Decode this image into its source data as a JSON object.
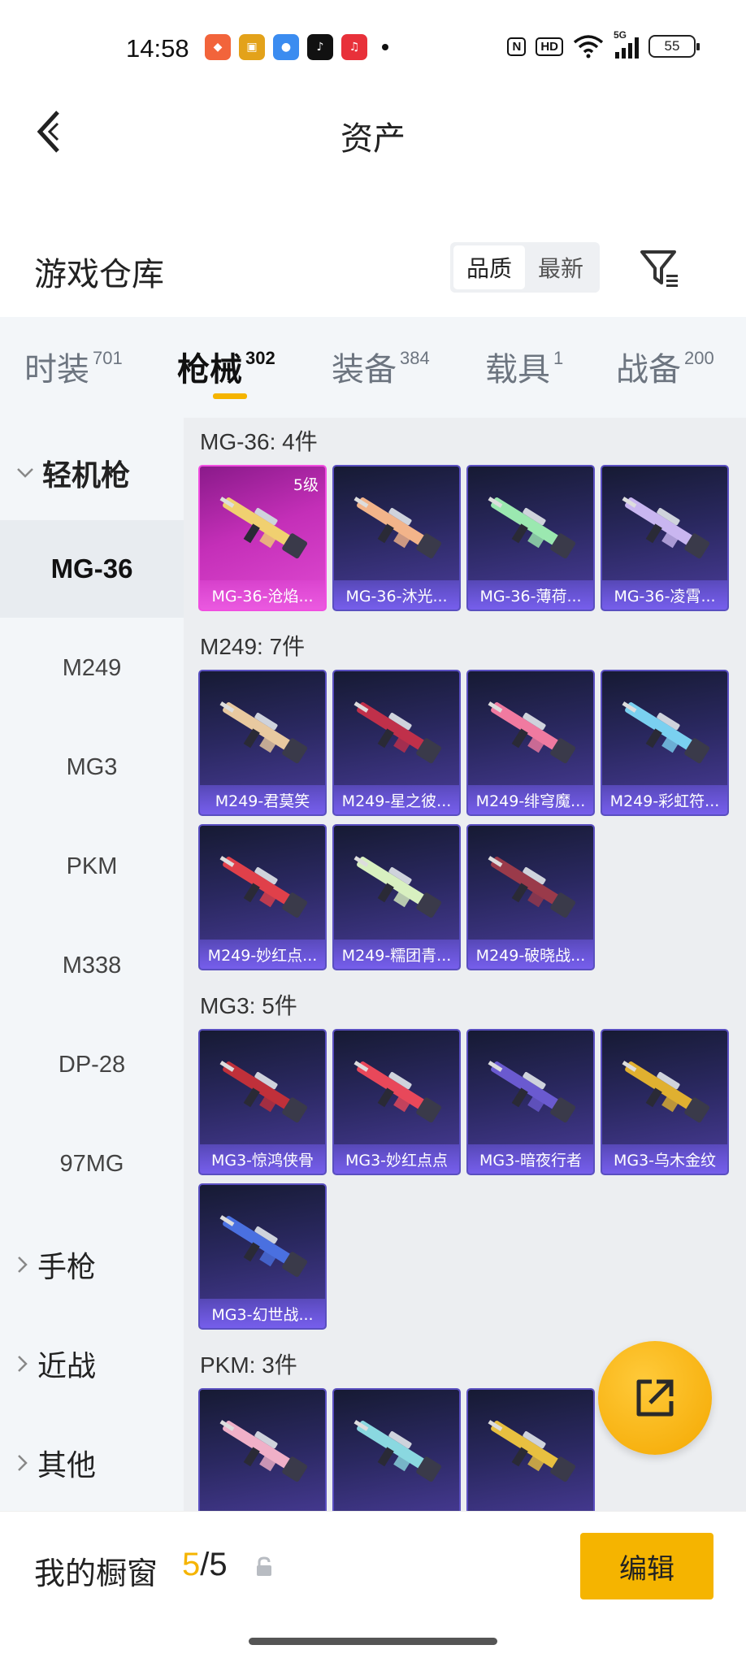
{
  "status": {
    "time": "14:58",
    "apps": [
      {
        "icon": "app-icon-orange",
        "color": "#f2643b",
        "glyph": "◆"
      },
      {
        "icon": "app-icon-game",
        "color": "#e3a21a",
        "glyph": "▣"
      },
      {
        "icon": "app-icon-blue",
        "color": "#3b8cf0",
        "glyph": "●"
      },
      {
        "icon": "tiktok-icon",
        "color": "#111111",
        "glyph": "♪"
      },
      {
        "icon": "music-icon",
        "color": "#e8313a",
        "glyph": "♫"
      }
    ],
    "nfc": "N",
    "hd": "HD",
    "network": "5G",
    "battery": "55"
  },
  "header": {
    "title": "资产"
  },
  "warehouse": {
    "title": "游戏仓库",
    "sort_quality": "品质",
    "sort_newest": "最新"
  },
  "tabs": [
    {
      "label": "时装",
      "count": "701"
    },
    {
      "label": "枪械",
      "count": "302"
    },
    {
      "label": "装备",
      "count": "384"
    },
    {
      "label": "载具",
      "count": "1"
    },
    {
      "label": "战备",
      "count": "200"
    }
  ],
  "sidebar": {
    "category_open": "轻机枪",
    "items": [
      "MG-36",
      "M249",
      "MG3",
      "PKM",
      "M338",
      "DP-28",
      "97MG"
    ],
    "categories": [
      "手枪",
      "近战",
      "其他"
    ]
  },
  "groups": [
    {
      "title": "MG-36: 4件",
      "cards": [
        {
          "label": "MG-36-沧焰...",
          "level": "5级",
          "rarity": "gold",
          "accent": "#f0d070"
        },
        {
          "label": "MG-36-沐光...",
          "rarity": "purple",
          "accent": "#f2b48a"
        },
        {
          "label": "MG-36-薄荷...",
          "rarity": "purple",
          "accent": "#9be8b0"
        },
        {
          "label": "MG-36-凌霄...",
          "rarity": "purple",
          "accent": "#c9b6f0"
        }
      ]
    },
    {
      "title": "M249: 7件",
      "cards": [
        {
          "label": "M249-君莫笑",
          "rarity": "purple",
          "accent": "#e8c9a0"
        },
        {
          "label": "M249-星之彼...",
          "rarity": "purple",
          "accent": "#c0304a"
        },
        {
          "label": "M249-绯穹魔...",
          "rarity": "purple",
          "accent": "#f07aa0"
        },
        {
          "label": "M249-彩虹符...",
          "rarity": "purple",
          "accent": "#7ad0f0"
        },
        {
          "label": "M249-妙红点...",
          "rarity": "purple",
          "accent": "#e0404a"
        },
        {
          "label": "M249-糯团青...",
          "rarity": "purple",
          "accent": "#d8f0c0"
        },
        {
          "label": "M249-破晓战...",
          "rarity": "purple",
          "accent": "#9a3a4a"
        }
      ]
    },
    {
      "title": "MG3: 5件",
      "cards": [
        {
          "label": "MG3-惊鸿侠骨",
          "rarity": "purple",
          "accent": "#c0303a"
        },
        {
          "label": "MG3-妙红点点",
          "rarity": "purple",
          "accent": "#e8485a"
        },
        {
          "label": "MG3-暗夜行者",
          "rarity": "purple",
          "accent": "#6a5ad0"
        },
        {
          "label": "MG3-乌木金纹",
          "rarity": "purple",
          "accent": "#e0b030"
        },
        {
          "label": "MG3-幻世战...",
          "rarity": "purple",
          "accent": "#4a70e0"
        }
      ]
    },
    {
      "title": "PKM: 3件",
      "cards": [
        {
          "label": "",
          "rarity": "purple",
          "accent": "#f0b0c8"
        },
        {
          "label": "",
          "rarity": "purple",
          "accent": "#8ad8e0"
        },
        {
          "label": "",
          "rarity": "purple",
          "accent": "#e8c040"
        }
      ]
    }
  ],
  "showcase": {
    "label": "我的橱窗",
    "current": "5",
    "total": "/5"
  },
  "edit_label": "编辑"
}
